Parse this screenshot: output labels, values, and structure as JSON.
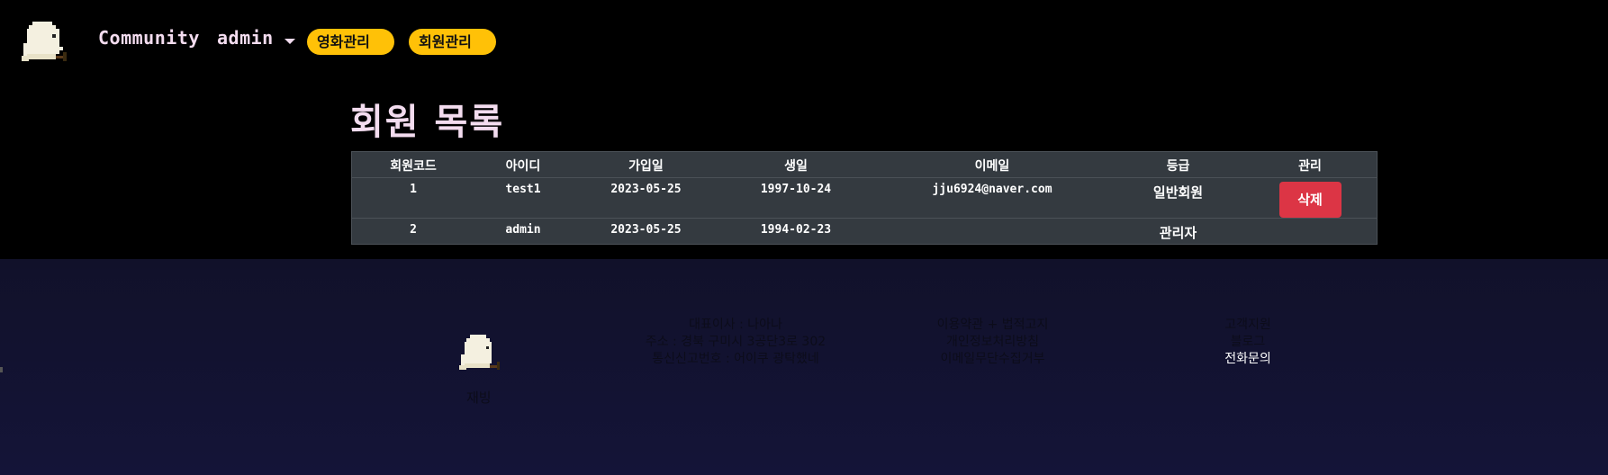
{
  "navbar": {
    "brand": "Community",
    "user": "admin",
    "buttons": [
      "영화관리",
      "회원관리"
    ]
  },
  "page": {
    "title": "회원 목록"
  },
  "table": {
    "headers": [
      "회원코드",
      "아이디",
      "가입일",
      "생일",
      "이메일",
      "등급",
      "관리"
    ],
    "rows": [
      {
        "code": "1",
        "id": "test1",
        "joined": "2023-05-25",
        "birthday": "1997-10-24",
        "email": "jju6924@naver.com",
        "grade": "일반회원",
        "action": "삭제"
      },
      {
        "code": "2",
        "id": "admin",
        "joined": "2023-05-25",
        "birthday": "1994-02-23",
        "email": "",
        "grade": "관리자",
        "action": ""
      }
    ]
  },
  "footer": {
    "name": "재빙",
    "company": [
      "대표이사 : 나아나",
      "주소 : 경북 구미시 3공단3로 302",
      "통신신고번호 : 어이쿠 광탁했네"
    ],
    "links": [
      "이용약관 + 법적고지",
      "개인정보처리방침",
      "이메일무단수집거부"
    ],
    "support": [
      "고객지원",
      "블로그",
      "전화문의"
    ]
  },
  "colors": {
    "accent": "#ffc107",
    "danger": "#dc3545",
    "table_bg": "#343a40",
    "title": "#f3dcef"
  },
  "icons": {
    "logo": "ghost-logo-icon",
    "dropdown": "chevron-down-icon"
  }
}
